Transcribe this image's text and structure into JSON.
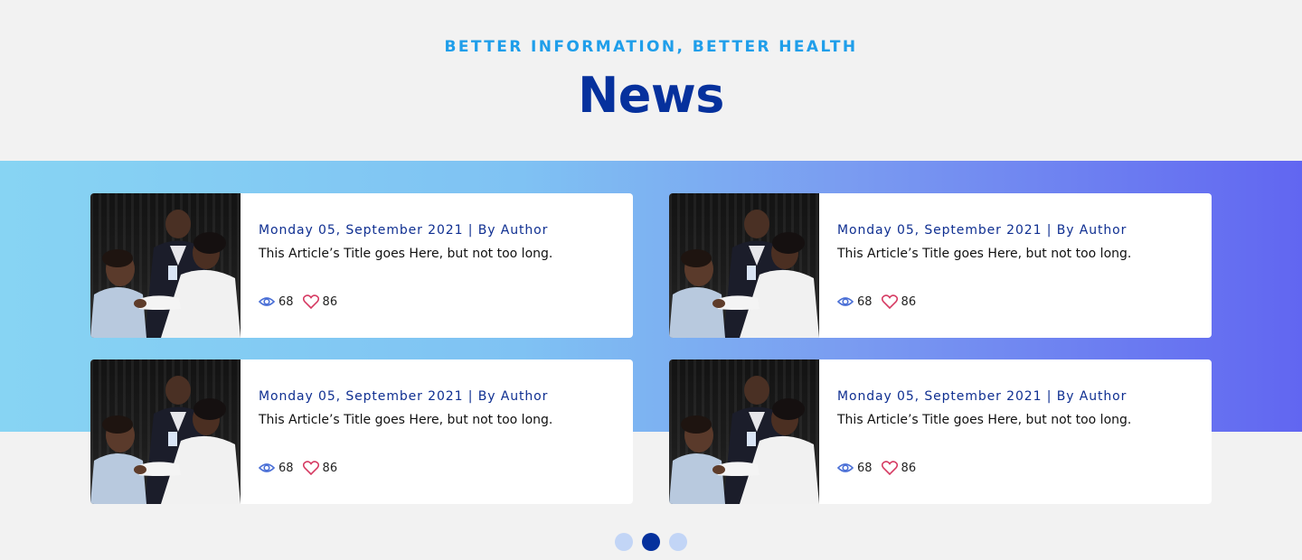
{
  "header": {
    "eyebrow": "BETTER INFORMATION, BETTER HEALTH",
    "title": "News"
  },
  "colors": {
    "eyebrow": "#1f9eea",
    "title": "#06319d",
    "band_start": "#87d4f3",
    "band_end": "#6166f1",
    "meta_text": "#0f2f91",
    "eye_icon": "#4a6fd6",
    "heart_icon": "#d63b63",
    "dot_active": "#06319d",
    "dot_inactive": "#c2d5f6"
  },
  "articles": [
    {
      "meta": "Monday 05, September 2021 | By Author",
      "title": "This Article’s Title goes Here, but not too long.",
      "views": "68",
      "likes": "86",
      "image_icon": "doctor-examining-patient-photo"
    },
    {
      "meta": "Monday 05, September 2021 | By Author",
      "title": "This Article’s Title goes Here, but not too long.",
      "views": "68",
      "likes": "86",
      "image_icon": "doctor-examining-patient-photo"
    },
    {
      "meta": "Monday 05, September 2021 | By Author",
      "title": "This Article’s Title goes Here, but not too long.",
      "views": "68",
      "likes": "86",
      "image_icon": "doctor-examining-patient-photo"
    },
    {
      "meta": "Monday 05, September 2021 | By Author",
      "title": "This Article’s Title goes Here, but not too long.",
      "views": "68",
      "likes": "86",
      "image_icon": "doctor-examining-patient-photo"
    }
  ],
  "pagination": {
    "pages": 3,
    "active_index": 1
  }
}
